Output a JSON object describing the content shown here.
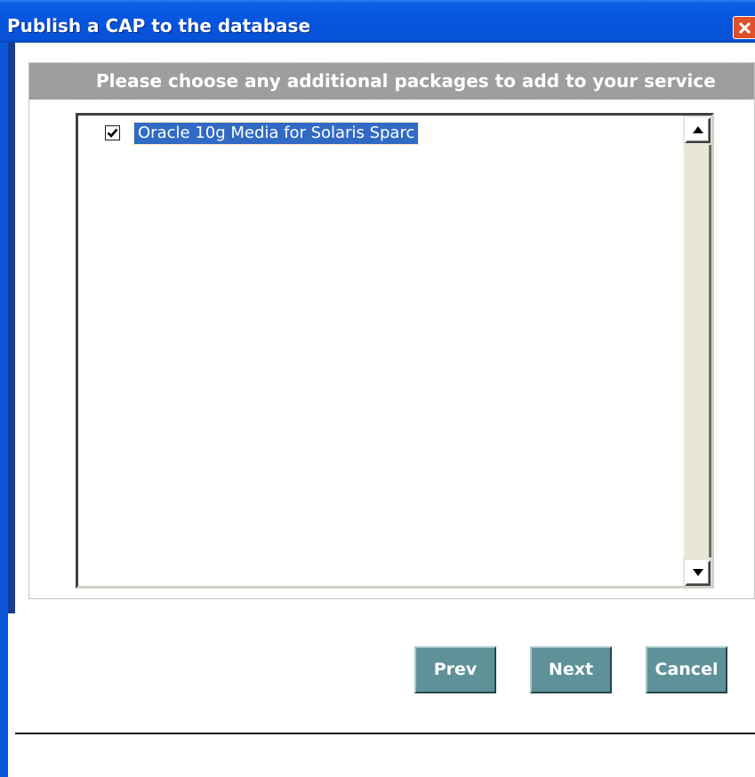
{
  "window": {
    "title": "Publish a CAP to the database",
    "close_icon": "close-icon"
  },
  "panel": {
    "header": "Please choose any additional packages to add to your service"
  },
  "packages": [
    {
      "label": "Oracle 10g Media for Solaris Sparc",
      "checked": true,
      "selected": true
    }
  ],
  "scrollbar": {
    "up_icon": "arrow-up-icon",
    "down_icon": "arrow-down-icon"
  },
  "buttons": {
    "prev": "Prev",
    "next": "Next",
    "cancel": "Cancel"
  },
  "colors": {
    "titlebar": "#0554de",
    "close_button": "#e0502a",
    "selection": "#316ac5",
    "button": "#5f9198",
    "panel_header": "#9e9e9e"
  }
}
